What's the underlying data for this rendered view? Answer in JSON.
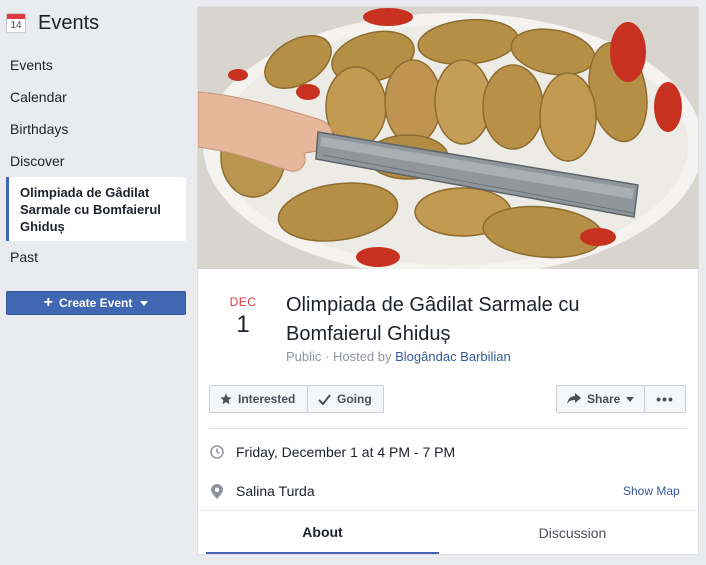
{
  "sidebar": {
    "calendar_icon_number": "14",
    "title": "Events",
    "items": [
      {
        "label": "Events"
      },
      {
        "label": "Calendar"
      },
      {
        "label": "Birthdays"
      },
      {
        "label": "Discover"
      },
      {
        "label": "Olimpiada de Gâdilat Sarmale cu Bomfaierul Ghiduș",
        "active": true
      },
      {
        "label": "Past"
      }
    ],
    "create_button": {
      "icon": "+",
      "label": "Create Event"
    }
  },
  "event": {
    "cover_icon": "food-photo",
    "date": {
      "month": "DEC",
      "day": "1"
    },
    "title": "Olimpiada de Gâdilat Sarmale cu Bomfaierul Ghiduș",
    "privacy": "Public",
    "hosted_by_prefix": " · Hosted by ",
    "host": "Blogândac Barbilian",
    "actions": {
      "interested": "Interested",
      "going": "Going",
      "share": "Share",
      "more": "•••"
    },
    "time": "Friday, December 1 at 4 PM - 7 PM",
    "location": "Salina Turda",
    "show_map": "Show Map"
  },
  "tabs": [
    {
      "label": "About",
      "active": true
    },
    {
      "label": "Discussion",
      "active": false
    }
  ],
  "colors": {
    "accent": "#4267b2",
    "date_month": "#e0393e",
    "link": "#365899"
  }
}
